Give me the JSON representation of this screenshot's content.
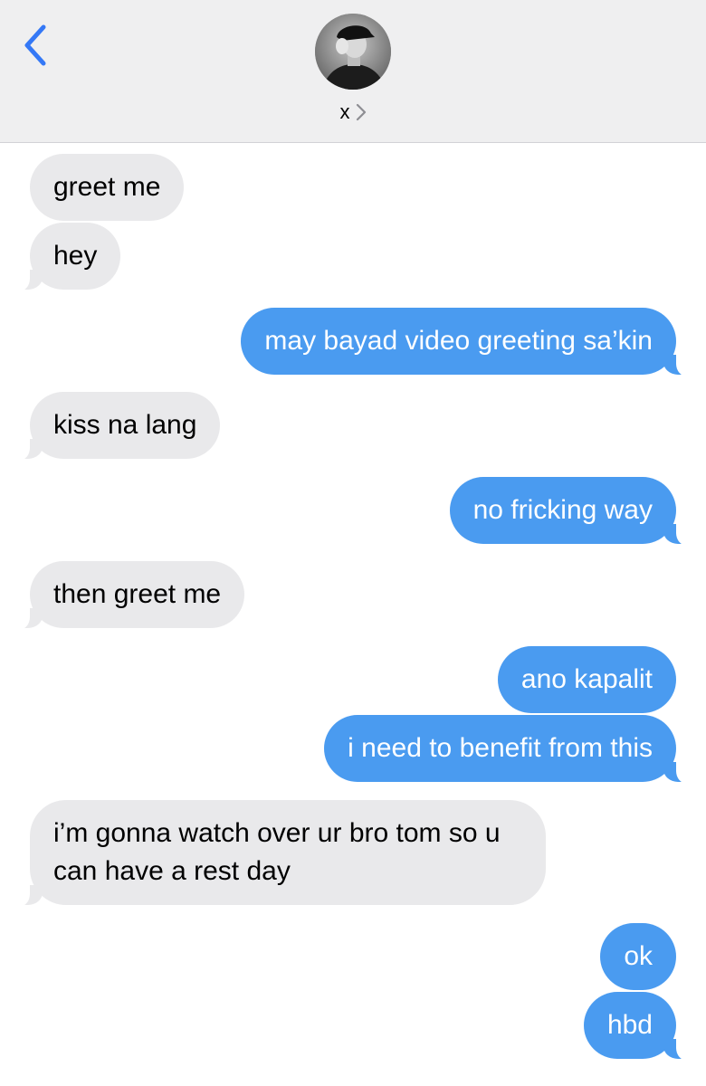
{
  "header": {
    "back_icon": "chevron-left-icon",
    "avatar_icon": "contact-photo",
    "contact_name": "x",
    "contact_chevron_icon": "chevron-right-icon",
    "accent_color": "#3478f6",
    "background_color": "#efeff0"
  },
  "messages": [
    {
      "direction": "incoming",
      "text": "greet me"
    },
    {
      "direction": "incoming",
      "text": "hey"
    },
    {
      "direction": "outgoing",
      "text": "may bayad video greeting sa’kin"
    },
    {
      "direction": "incoming",
      "text": "kiss na lang"
    },
    {
      "direction": "outgoing",
      "text": "no fricking way"
    },
    {
      "direction": "incoming",
      "text": "then greet me"
    },
    {
      "direction": "outgoing",
      "text": "ano kapalit"
    },
    {
      "direction": "outgoing",
      "text": "i need to benefit from this"
    },
    {
      "direction": "incoming",
      "text": "i’m gonna watch over ur bro tom so u can have a rest day"
    },
    {
      "direction": "outgoing",
      "text": "ok"
    },
    {
      "direction": "outgoing",
      "text": "hbd"
    }
  ],
  "colors": {
    "incoming_bubble": "#e9e9eb",
    "outgoing_bubble": "#4a9bf0",
    "incoming_text": "#000000",
    "outgoing_text": "#ffffff"
  }
}
